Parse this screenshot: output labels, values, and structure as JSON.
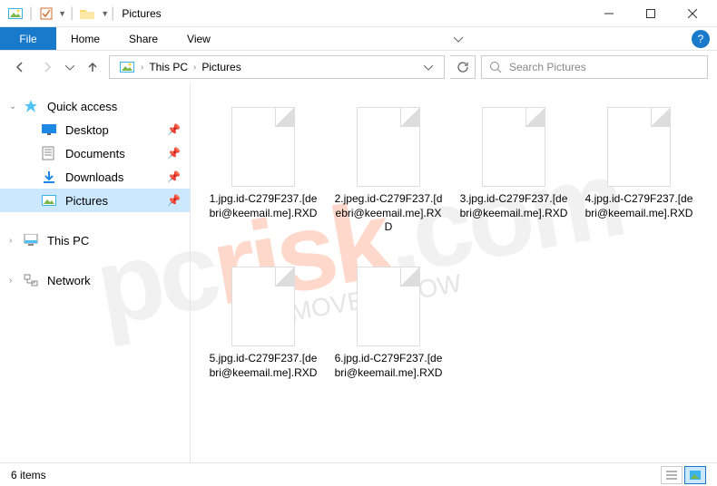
{
  "titlebar": {
    "title": "Pictures"
  },
  "ribbon": {
    "file": "File",
    "tabs": [
      "Home",
      "Share",
      "View"
    ]
  },
  "breadcrumb": {
    "items": [
      "This PC",
      "Pictures"
    ]
  },
  "search": {
    "placeholder": "Search Pictures"
  },
  "sidebar": {
    "quick_access": "Quick access",
    "quick_items": [
      {
        "label": "Desktop",
        "icon": "desktop"
      },
      {
        "label": "Documents",
        "icon": "documents"
      },
      {
        "label": "Downloads",
        "icon": "downloads"
      },
      {
        "label": "Pictures",
        "icon": "pictures"
      }
    ],
    "this_pc": "This PC",
    "network": "Network"
  },
  "files": [
    {
      "name": "1.jpg.id-C279F237.[debri@keemail.me].RXD"
    },
    {
      "name": "2.jpeg.id-C279F237.[debri@keemail.me].RXD"
    },
    {
      "name": "3.jpg.id-C279F237.[debri@keemail.me].RXD"
    },
    {
      "name": "4.jpg.id-C279F237.[debri@keemail.me].RXD"
    },
    {
      "name": "5.jpg.id-C279F237.[debri@keemail.me].RXD"
    },
    {
      "name": "6.jpg.id-C279F237.[debri@keemail.me].RXD"
    }
  ],
  "statusbar": {
    "count": "6 items"
  },
  "watermark": {
    "pc": "pc",
    "risk": "risk",
    "dotcom": ".com",
    "sub": "REMOVE IT NOW"
  }
}
